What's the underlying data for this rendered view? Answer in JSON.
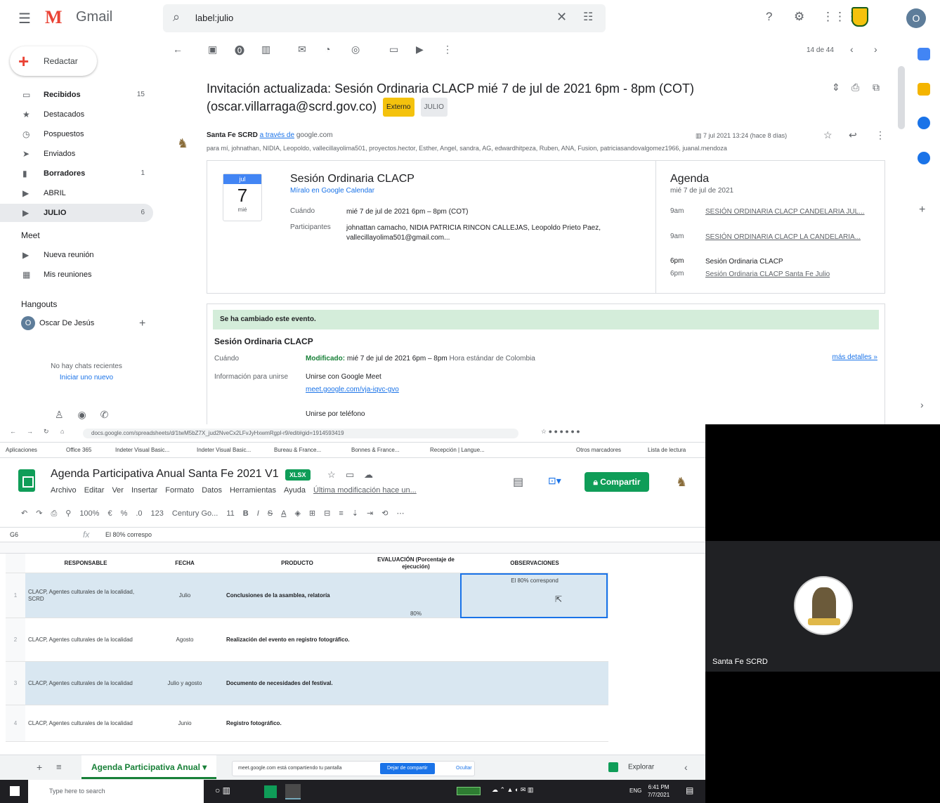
{
  "gmail": {
    "brand": "Gmail",
    "search_query": "label:julio",
    "compose_label": "Redactar",
    "nav": [
      {
        "label": "Recibidos",
        "count": "15",
        "bold": true
      },
      {
        "label": "Destacados",
        "count": ""
      },
      {
        "label": "Pospuestos",
        "count": ""
      },
      {
        "label": "Enviados",
        "count": ""
      },
      {
        "label": "Borradores",
        "count": "1",
        "bold": true
      },
      {
        "label": "ABRIL",
        "count": ""
      },
      {
        "label": "JULIO",
        "count": "6",
        "bold": true,
        "selected": true
      }
    ],
    "meet_section": "Meet",
    "meet_items": [
      "Nueva reunión",
      "Mis reuniones"
    ],
    "hangouts_section": "Hangouts",
    "hangouts_user": "Oscar De Jesús",
    "hangouts_initial": "O",
    "no_chats": "No hay chats recientes",
    "start_new": "Iniciar uno nuevo",
    "message_count": "14 de 44",
    "subject": "Invitación actualizada: Sesión Ordinaria CLACP mié 7 de jul de 2021 6pm - 8pm (COT) (oscar.villarraga@scrd.gov.co)",
    "label_external": "Externo",
    "label_julio": "JULIO",
    "sender_name": "Santa Fe SCRD",
    "sender_via": "a través de",
    "sender_domain": "google.com",
    "recipients": "para mí, johnathan, NIDIA, Leopoldo, vallecillayolima501, proyectos.hector, Esther, Angel, sandra, AG, edwardhitpeza, Ruben, ANA, Fusion, patriciasandovalgomez1966, juanal.mendoza",
    "message_date": "7 jul 2021 13:24 (hace 8 días)",
    "avatar_initial": "O",
    "invite": {
      "month": "jul",
      "day": "7",
      "weekday": "mié",
      "title": "Sesión Ordinaria CLACP",
      "calendar_link": "Míralo en Google Calendar",
      "when_label": "Cuándo",
      "when_value": "mié 7 de jul de 2021 6pm – 8pm (COT)",
      "participants_label": "Participantes",
      "participants_value": "johnattan camacho, NIDIA PATRICIA RINCON CALLEJAS, Leopoldo Prieto Paez, vallecillayolima501@gmail.com..."
    },
    "agenda": {
      "title": "Agenda",
      "date": "mié 7 de jul de 2021",
      "events": [
        {
          "time": "9am",
          "title": "SESIÓN ORDINARIA CLACP CANDELARIA JUL...",
          "current": false
        },
        {
          "time": "9am",
          "title": "SESIÓN ORDINARIA CLACP LA CANDELARIA...",
          "current": false
        },
        {
          "time": "6pm",
          "title": "Sesión Ordinaria CLACP",
          "current": true
        },
        {
          "time": "6pm",
          "title": "Sesión Ordinaria CLACP Santa Fe Julio",
          "current": false
        }
      ]
    },
    "changed": {
      "banner": "Se ha cambiado este evento.",
      "title": "Sesión Ordinaria CLACP",
      "when_label": "Cuándo",
      "modified": "Modificado:",
      "when_value": "mié 7 de jul de 2021 6pm – 8pm",
      "tz": "Hora estándar de Colombia",
      "more": "más detalles »",
      "join_label": "Información para unirse",
      "join_meet": "Unirse con Google Meet",
      "meet_link": "meet.google.com/vja-iqvc-gvo",
      "join_phone": "Unirse por teléfono"
    }
  },
  "browser": {
    "url": "docs.google.com/spreadsheets/d/1twM5bZ7X_jud2NveCx2LFvJyHxwmRgpl-r9/edit#gid=1914593419",
    "bookmarks": [
      "Aplicaciones",
      "Office 365",
      "Indeter Visual Basic...",
      "Indeter Visual Basic...",
      "Bureau & France...",
      "Bonnes & France...",
      "Recepción | Langue...",
      "Otros marcadores",
      "Lista de lectura"
    ]
  },
  "sheets": {
    "title": "Agenda Participativa Anual Santa Fe 2021 V1",
    "badge": "XLSX",
    "menu": [
      "Archivo",
      "Editar",
      "Ver",
      "Insertar",
      "Formato",
      "Datos",
      "Herramientas",
      "Ayuda"
    ],
    "last_edit": "Última modificación hace un...",
    "share": "Compartir",
    "font": "Century Go...",
    "font_size": "11",
    "zoom": "100%",
    "format_123": "123",
    "cell_ref": "G6",
    "cell_value": "El 80% correspo",
    "headers": [
      "RESPONSABLE",
      "FECHA",
      "PRODUCTO",
      "EVALUACIÓN (Porcentaje de ejecución)",
      "OBSERVACIONES"
    ],
    "rows": [
      {
        "n": "1",
        "resp": "CLACP, Agentes culturales de la localidad, SCRD",
        "fecha": "Julio",
        "producto": "Conclusiones de la asamblea, relatoría",
        "eval": "80%",
        "obs": "El 80% correspond",
        "hl": true
      },
      {
        "n": "2",
        "resp": "CLACP, Agentes culturales de la localidad",
        "fecha": "Agosto",
        "producto": "Realización del evento en registro fotográfico.",
        "eval": "",
        "obs": "",
        "hl": false
      },
      {
        "n": "3",
        "resp": "CLACP, Agentes culturales de la localidad",
        "fecha": "Julio y agosto",
        "producto": "Documento de necesidades del festival.",
        "eval": "",
        "obs": "",
        "hl": true
      },
      {
        "n": "4",
        "resp": "CLACP, Agentes culturales de la localidad",
        "fecha": "Junio",
        "producto": "Registro fotográfico.",
        "eval": "",
        "obs": "",
        "hl": false
      }
    ],
    "sheet_tab": "Agenda Participativa Anual",
    "sharing_text": "meet.google.com está compartiendo tu pantalla",
    "stop_sharing": "Dejar de compartir",
    "hide": "Ocultar",
    "explore": "Explorar"
  },
  "taskbar": {
    "search": "Type here to search",
    "time": "6:41 PM",
    "date": "7/7/2021",
    "lang": "ENG"
  },
  "meet": {
    "participant": "Santa Fe SCRD"
  }
}
